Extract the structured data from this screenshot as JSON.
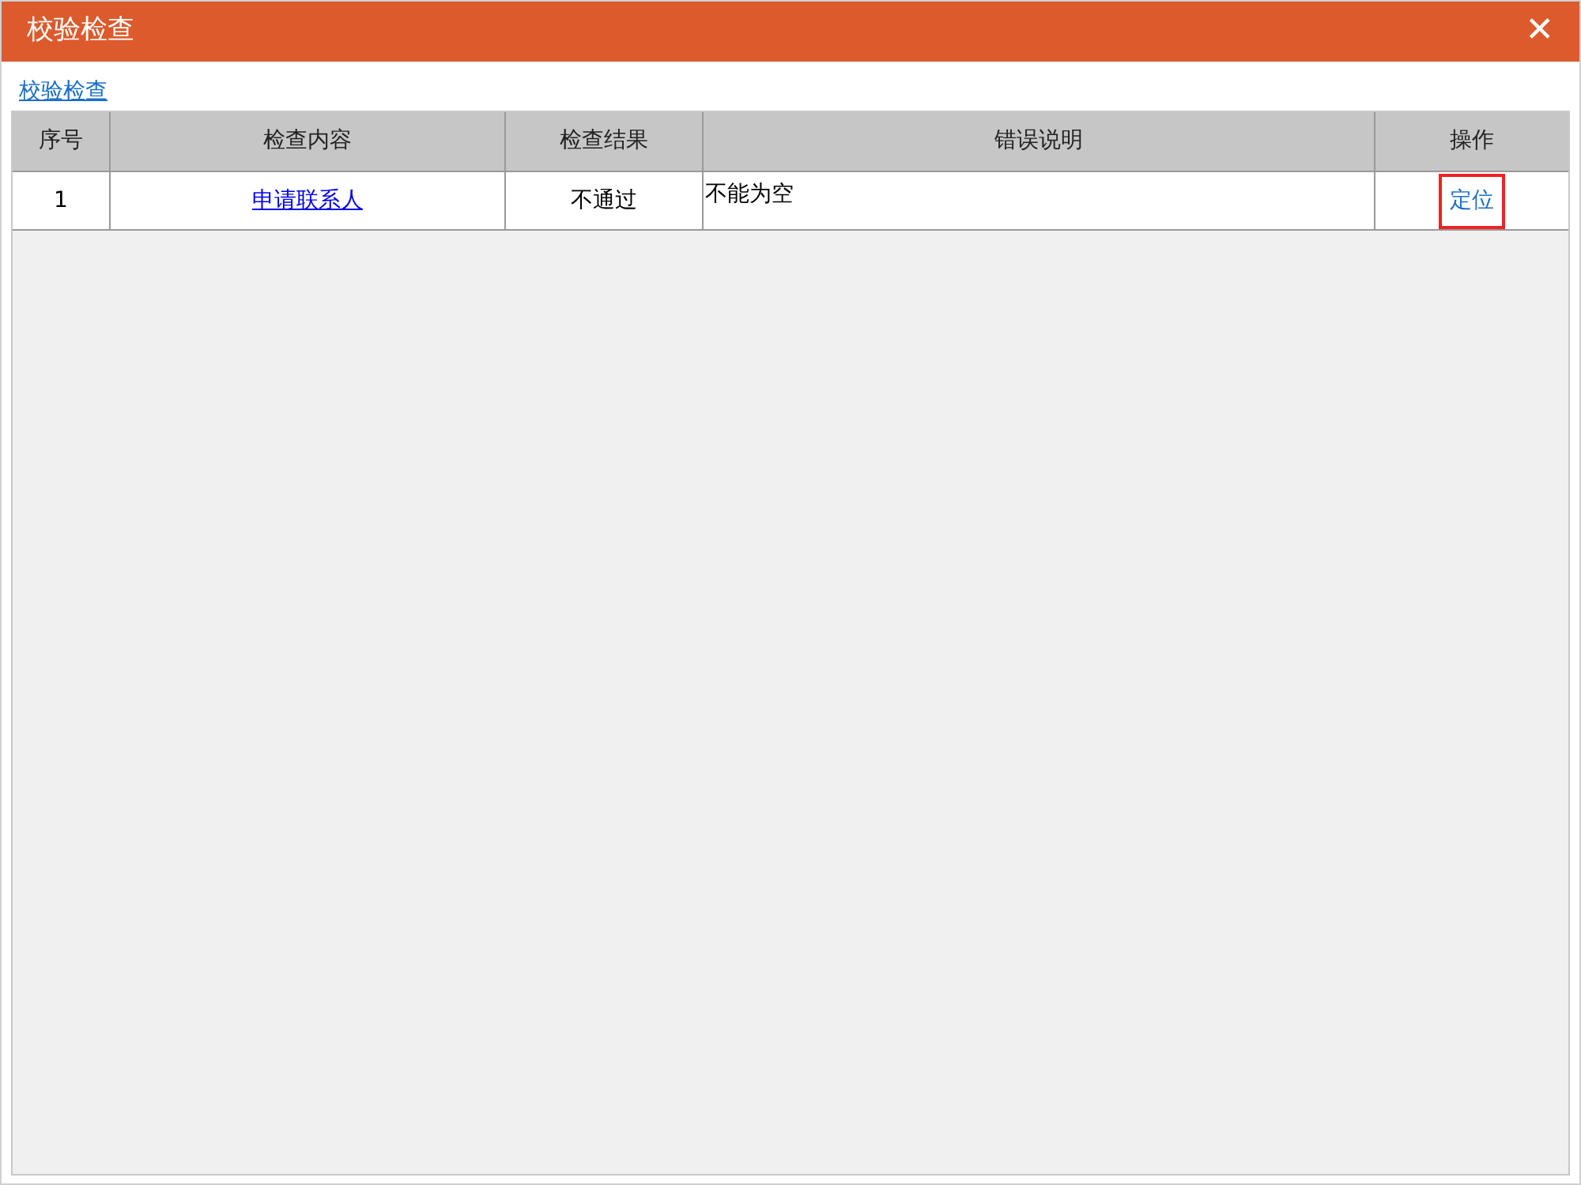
{
  "window": {
    "title": "校验检查",
    "close": "✕"
  },
  "breadcrumb": "校验检查",
  "table": {
    "columns": [
      "序号",
      "检查内容",
      "检查结果",
      "错误说明",
      "操作"
    ],
    "rows": [
      {
        "index": "1",
        "item": "申请联系人",
        "result": "不通过",
        "error": "不能为空",
        "action": "定位",
        "action_highlighted": true
      }
    ]
  }
}
